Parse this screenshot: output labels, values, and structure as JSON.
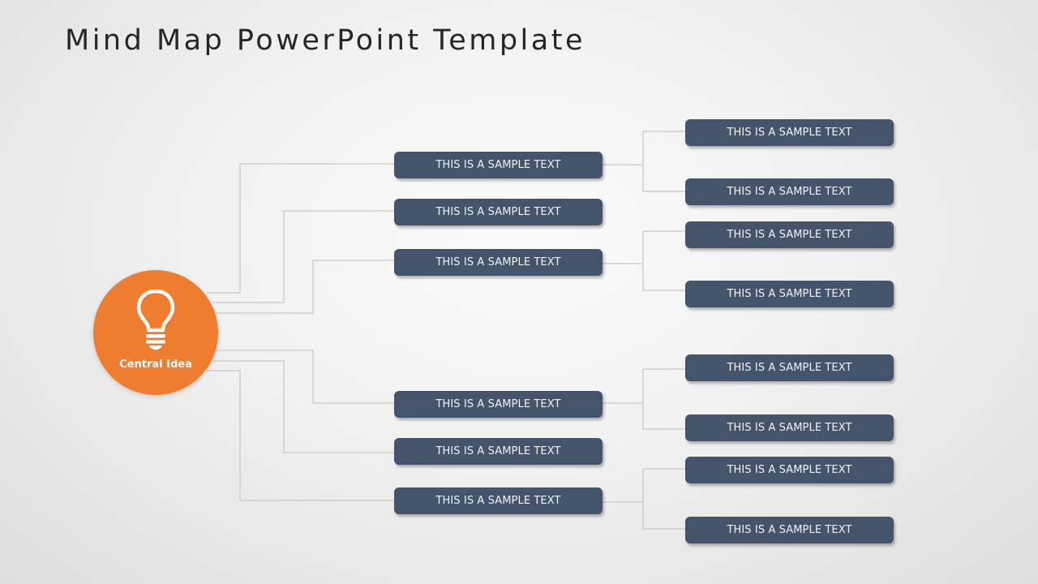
{
  "slide": {
    "title": "Mind Map PowerPoint Template",
    "colors": {
      "central": "#ef7d30",
      "node": "#44546a",
      "connector": "#c8c8c8"
    }
  },
  "central": {
    "label": "Central Idea",
    "icon": "lightbulb-icon"
  },
  "branches": [
    {
      "label": "THIS IS A SAMPLE TEXT",
      "children": [
        {
          "label": "THIS IS A SAMPLE TEXT"
        },
        {
          "label": "THIS IS A SAMPLE TEXT"
        }
      ]
    },
    {
      "label": "THIS IS A SAMPLE TEXT",
      "children": []
    },
    {
      "label": "THIS IS A SAMPLE TEXT",
      "children": [
        {
          "label": "THIS IS A SAMPLE TEXT"
        },
        {
          "label": "THIS IS A SAMPLE TEXT"
        }
      ]
    },
    {
      "label": "THIS IS A SAMPLE TEXT",
      "children": [
        {
          "label": "THIS IS A SAMPLE TEXT"
        },
        {
          "label": "THIS IS A SAMPLE TEXT"
        }
      ]
    },
    {
      "label": "THIS IS A SAMPLE TEXT",
      "children": []
    },
    {
      "label": "THIS IS A SAMPLE TEXT",
      "children": [
        {
          "label": "THIS IS A SAMPLE TEXT"
        },
        {
          "label": "THIS IS A SAMPLE TEXT"
        }
      ]
    }
  ]
}
